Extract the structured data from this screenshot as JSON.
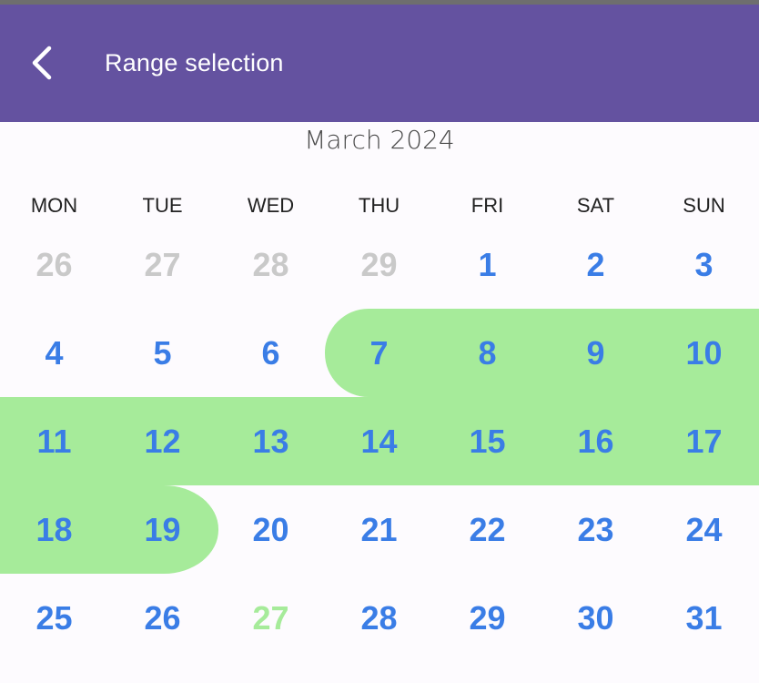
{
  "app_bar": {
    "title": "Range selection",
    "back_icon": "chevron-left-icon",
    "background_color": "#6452a0"
  },
  "calendar": {
    "month_title": "March 2024",
    "weekdays": [
      "MON",
      "TUE",
      "WED",
      "THU",
      "FRI",
      "SAT",
      "SUN"
    ],
    "colors": {
      "day_text": "#3a7de6",
      "other_month_text": "#c9c9c9",
      "today_text": "#a6eb9a",
      "range_fill": "#a6eb9a"
    },
    "selected_range": {
      "start": 7,
      "end": 19
    },
    "weeks": [
      [
        {
          "label": "26",
          "state": "other-month"
        },
        {
          "label": "27",
          "state": "other-month"
        },
        {
          "label": "28",
          "state": "other-month"
        },
        {
          "label": "29",
          "state": "other-month"
        },
        {
          "label": "1",
          "state": "normal"
        },
        {
          "label": "2",
          "state": "normal"
        },
        {
          "label": "3",
          "state": "normal"
        }
      ],
      [
        {
          "label": "4",
          "state": "normal"
        },
        {
          "label": "5",
          "state": "normal"
        },
        {
          "label": "6",
          "state": "normal"
        },
        {
          "label": "7",
          "state": "range-start"
        },
        {
          "label": "8",
          "state": "in-range"
        },
        {
          "label": "9",
          "state": "in-range"
        },
        {
          "label": "10",
          "state": "in-range"
        }
      ],
      [
        {
          "label": "11",
          "state": "in-range"
        },
        {
          "label": "12",
          "state": "in-range"
        },
        {
          "label": "13",
          "state": "in-range"
        },
        {
          "label": "14",
          "state": "in-range"
        },
        {
          "label": "15",
          "state": "in-range"
        },
        {
          "label": "16",
          "state": "in-range"
        },
        {
          "label": "17",
          "state": "in-range"
        }
      ],
      [
        {
          "label": "18",
          "state": "in-range"
        },
        {
          "label": "19",
          "state": "range-end"
        },
        {
          "label": "20",
          "state": "normal"
        },
        {
          "label": "21",
          "state": "normal"
        },
        {
          "label": "22",
          "state": "normal"
        },
        {
          "label": "23",
          "state": "normal"
        },
        {
          "label": "24",
          "state": "normal"
        }
      ],
      [
        {
          "label": "25",
          "state": "normal"
        },
        {
          "label": "26",
          "state": "normal"
        },
        {
          "label": "27",
          "state": "today"
        },
        {
          "label": "28",
          "state": "normal"
        },
        {
          "label": "29",
          "state": "normal"
        },
        {
          "label": "30",
          "state": "normal"
        },
        {
          "label": "31",
          "state": "normal"
        }
      ]
    ]
  }
}
